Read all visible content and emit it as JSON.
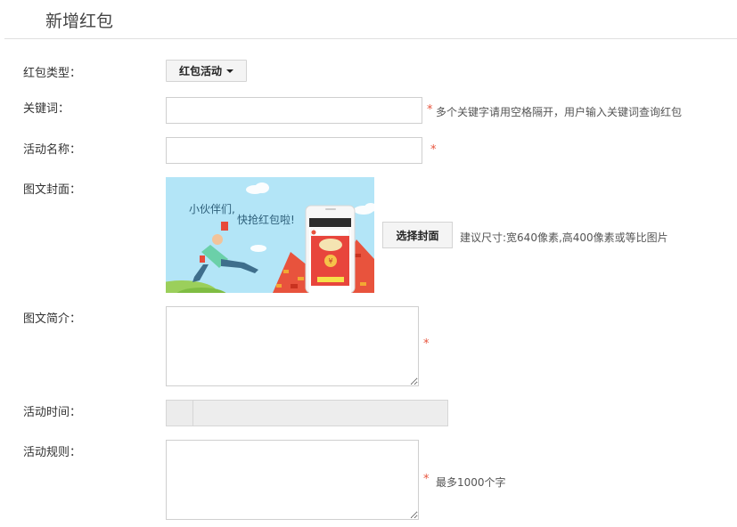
{
  "header": {
    "title": "新增红包"
  },
  "form": {
    "type": {
      "label": "红包类型：",
      "value": "红包活动"
    },
    "keywords": {
      "label": "关键词：",
      "value": "",
      "required_mark": "*",
      "hint": "多个关键字请用空格隔开，用户输入关键词查询红包"
    },
    "name": {
      "label": "活动名称：",
      "value": "",
      "required_mark": "*"
    },
    "cover": {
      "label": "图文封面：",
      "button_label": "选择封面",
      "hint": "建议尺寸:宽640像素,高400像素或等比图片",
      "image_text_line1": "小伙伴们,",
      "image_text_line2": "快抢红包啦!"
    },
    "intro": {
      "label": "图文简介：",
      "value": "",
      "required_mark": "*"
    },
    "time": {
      "label": "活动时间：",
      "value": ""
    },
    "rules": {
      "label": "活动规则：",
      "value": "",
      "required_mark": "*",
      "hint": "最多1000个字"
    }
  }
}
